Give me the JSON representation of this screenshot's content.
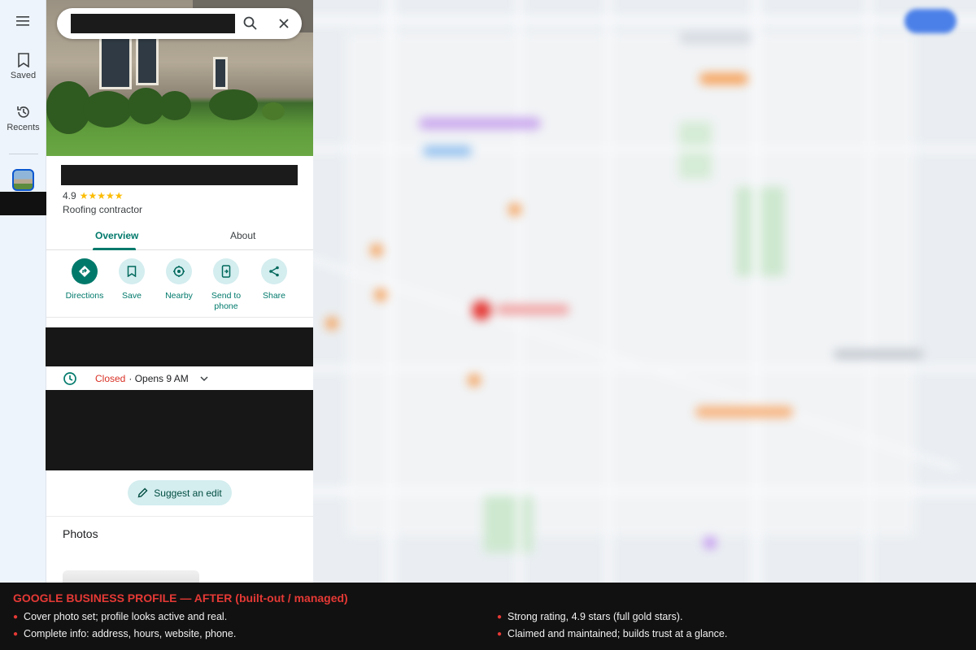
{
  "rail": {
    "saved_label": "Saved",
    "recents_label": "Recents"
  },
  "place": {
    "rating": "4.9",
    "stars": "★★★★★",
    "category": "Roofing contractor"
  },
  "tabs": [
    {
      "label": "Overview",
      "active": true
    },
    {
      "label": "About",
      "active": false
    }
  ],
  "actions": [
    {
      "label": "Directions",
      "icon": "directions-icon"
    },
    {
      "label": "Save",
      "icon": "bookmark-icon"
    },
    {
      "label": "Nearby",
      "icon": "nearby-icon"
    },
    {
      "label": "Send to phone",
      "icon": "send-to-phone-icon"
    },
    {
      "label": "Share",
      "icon": "share-icon"
    }
  ],
  "hours": {
    "status": "Closed",
    "detail": "· Opens 9 AM"
  },
  "suggest_edit_label": "Suggest an edit",
  "photos_heading": "Photos",
  "caption": {
    "title": "GOOGLE BUSINESS PROFILE — AFTER (built-out / managed)",
    "bullets": [
      "Cover photo set; profile looks active and real.",
      "Complete info: address, hours, website, phone.",
      "Strong rating, 4.9 stars (full gold stars).",
      "Claimed and maintained; builds trust at a glance."
    ]
  },
  "colors": {
    "accent": "#00796b",
    "closed": "#d93025",
    "caption_title": "#e53935",
    "star": "#fbbc04"
  }
}
